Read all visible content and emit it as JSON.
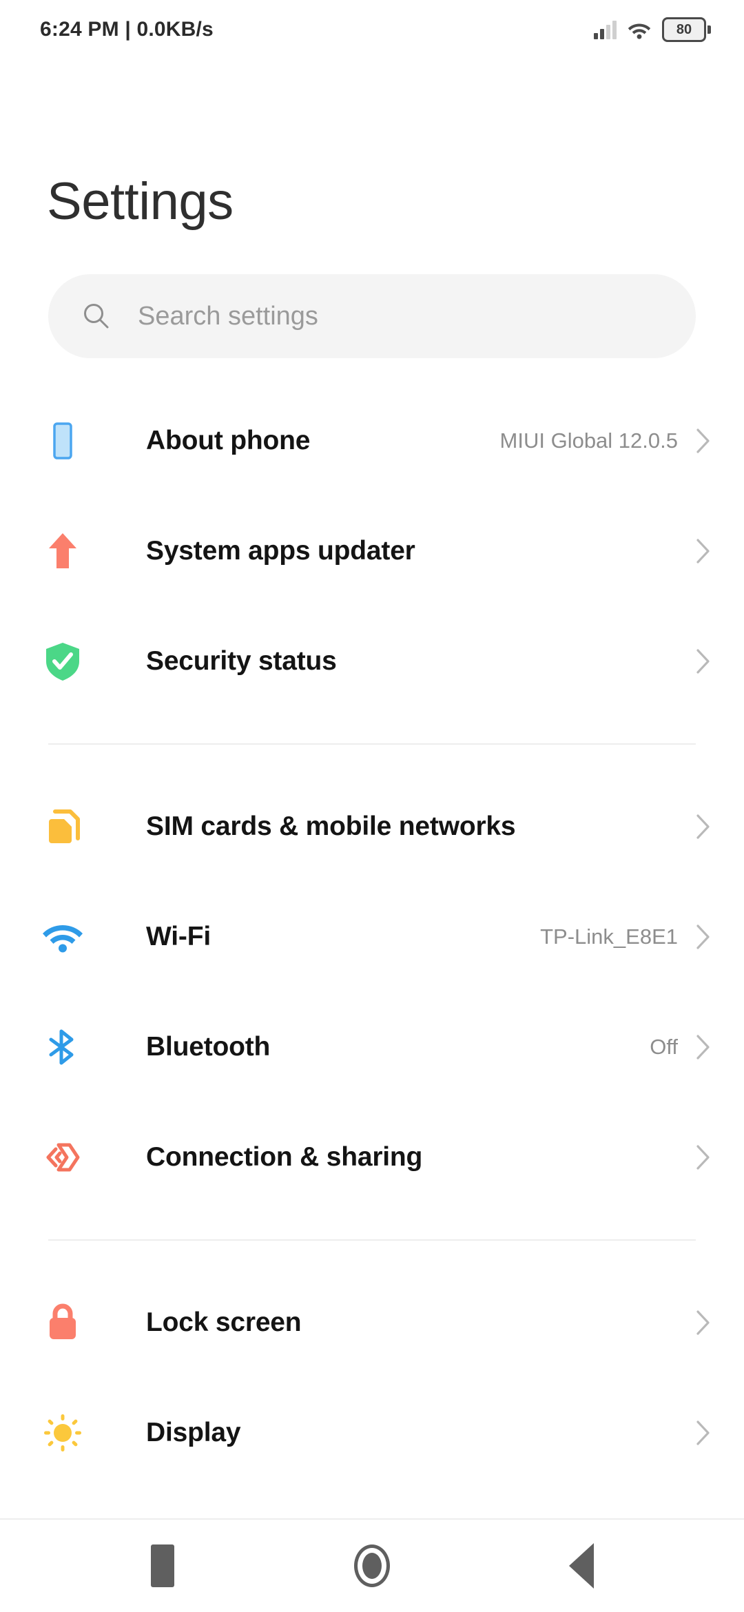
{
  "statusbar": {
    "time_and_network": "6:24 PM | 0.0KB/s",
    "signal_icon": "signal-bars-icon",
    "signal_bars_filled": 2,
    "signal_bars_total": 4,
    "wifi_icon": "wifi-icon",
    "battery_icon": "battery-icon",
    "battery_level": "80"
  },
  "header": {
    "title": "Settings"
  },
  "search": {
    "icon": "search-icon",
    "placeholder": "Search settings",
    "value": ""
  },
  "groups": [
    {
      "items": [
        {
          "label": "About phone",
          "value": "MIUI Global 12.0.5",
          "icon": "phone-icon",
          "icon_color": "#A8D8F8",
          "name": "about-phone"
        },
        {
          "label": "System apps updater",
          "value": "",
          "icon": "up-arrow-icon",
          "icon_color": "#FB7F6C",
          "name": "system-apps-updater"
        },
        {
          "label": "Security status",
          "value": "",
          "icon": "shield-check-icon",
          "icon_color": "#4BD787",
          "name": "security-status"
        }
      ]
    },
    {
      "items": [
        {
          "label": "SIM cards & mobile networks",
          "value": "",
          "icon": "sim-cards-icon",
          "icon_color": "#FBBE3C",
          "name": "sim-cards-mobile-networks"
        },
        {
          "label": "Wi-Fi",
          "value": "TP-Link_E8E1",
          "icon": "wifi-icon",
          "icon_color": "#2E9BE8",
          "name": "wifi"
        },
        {
          "label": "Bluetooth",
          "value": "Off",
          "icon": "bluetooth-icon",
          "icon_color": "#2E9BE8",
          "name": "bluetooth"
        },
        {
          "label": "Connection & sharing",
          "value": "",
          "icon": "connection-sharing-icon",
          "icon_color": "#F4745E",
          "name": "connection-sharing"
        }
      ]
    },
    {
      "items": [
        {
          "label": "Lock screen",
          "value": "",
          "icon": "lock-icon",
          "icon_color": "#FB7F6C",
          "name": "lock-screen"
        },
        {
          "label": "Display",
          "value": "",
          "icon": "sun-icon",
          "icon_color": "#FBC83C",
          "name": "display"
        }
      ]
    }
  ],
  "navbar": {
    "recents_label": "recents",
    "home_label": "home",
    "back_label": "back"
  }
}
